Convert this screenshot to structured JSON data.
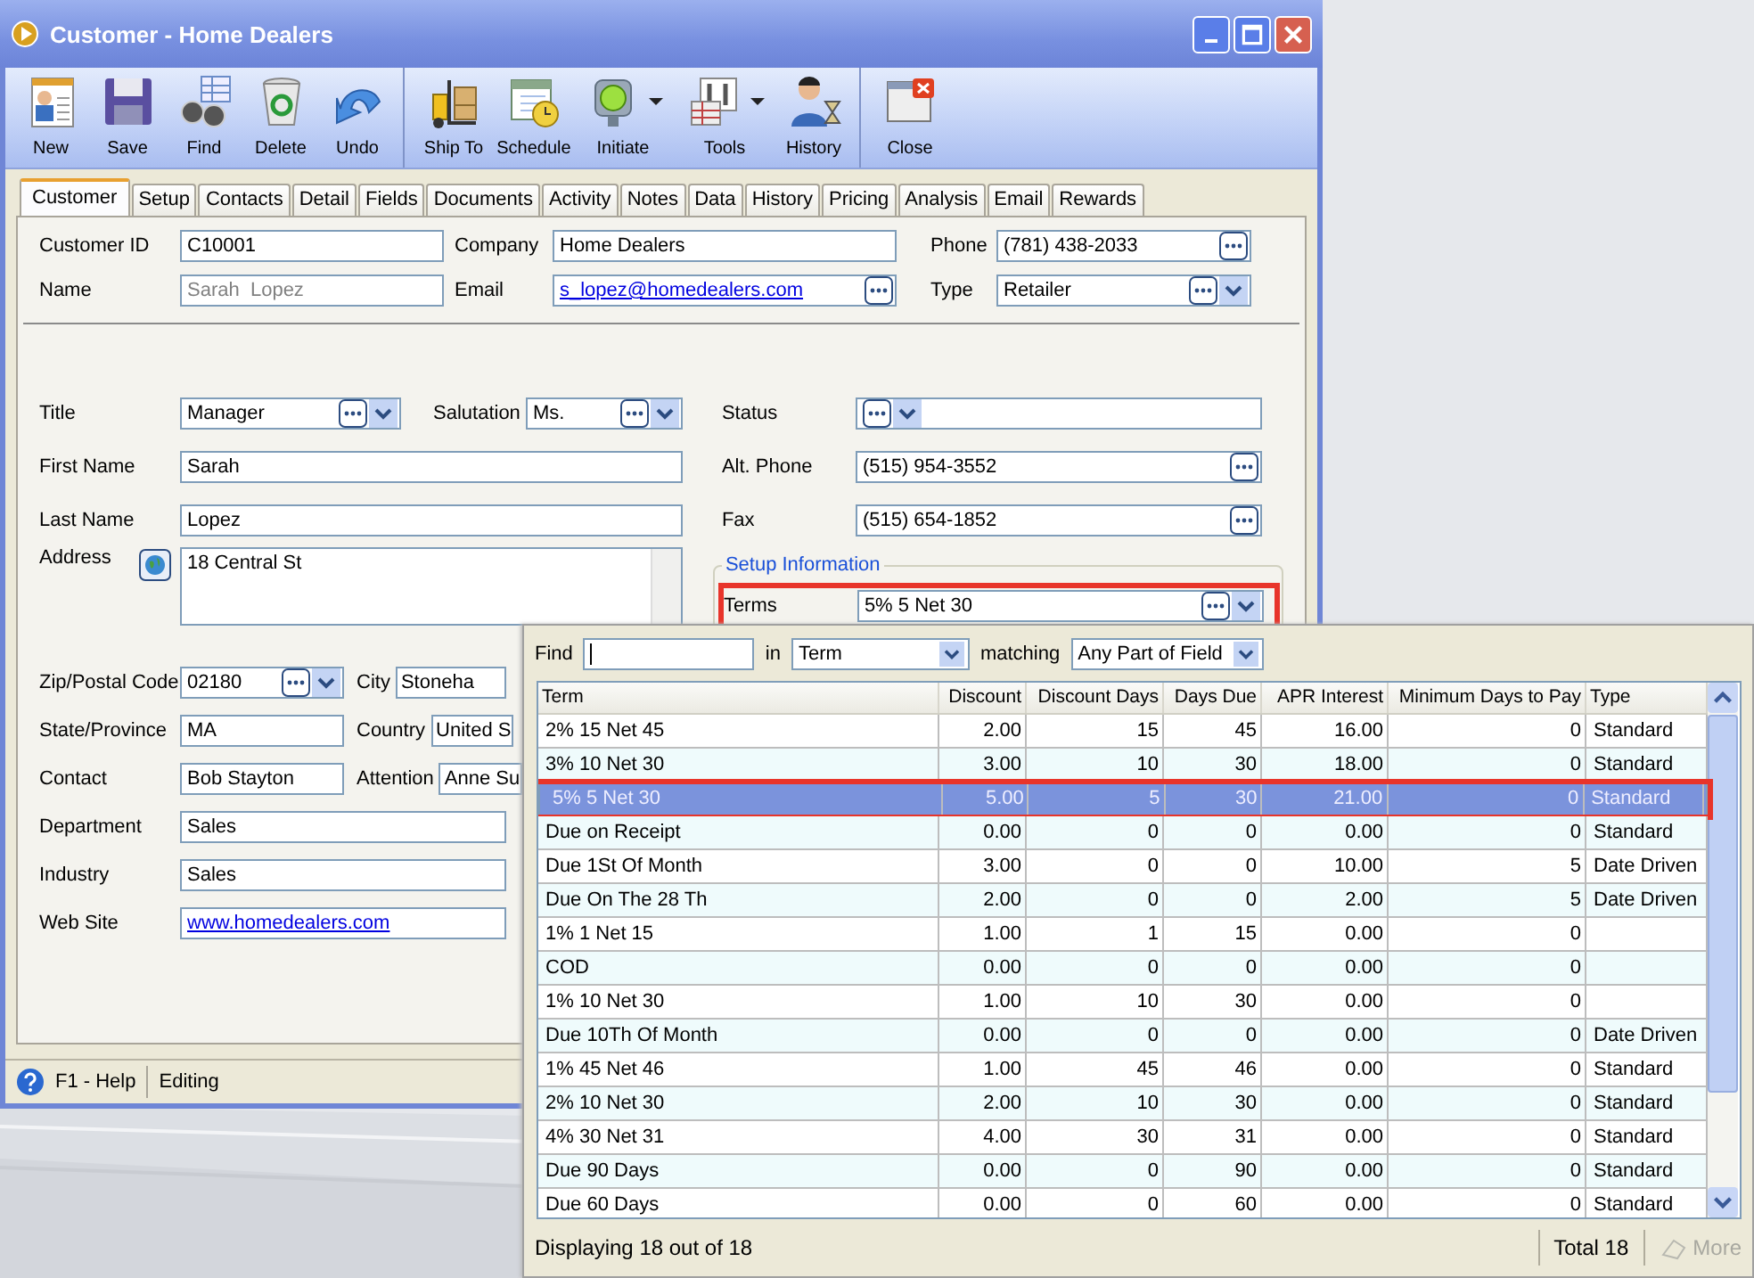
{
  "window": {
    "title": "Customer - Home Dealers"
  },
  "toolbar": [
    {
      "label": "New",
      "menu": false,
      "separator_before": false
    },
    {
      "label": "Save",
      "menu": false,
      "separator_before": false
    },
    {
      "label": "Find",
      "menu": false,
      "separator_before": false
    },
    {
      "label": "Delete",
      "menu": false,
      "separator_before": false
    },
    {
      "label": "Undo",
      "menu": false,
      "separator_before": false
    },
    {
      "label": "Ship To",
      "menu": false,
      "separator_before": true
    },
    {
      "label": "Schedule",
      "menu": false,
      "separator_before": false
    },
    {
      "label": "Initiate",
      "menu": true,
      "separator_before": false
    },
    {
      "label": "Tools",
      "menu": true,
      "separator_before": false
    },
    {
      "label": "History",
      "menu": false,
      "separator_before": false
    },
    {
      "label": "Close",
      "menu": false,
      "separator_before": true
    }
  ],
  "tabs": [
    {
      "label": "Customer",
      "selected": true
    },
    {
      "label": "Setup",
      "selected": false
    },
    {
      "label": "Contacts",
      "selected": false
    },
    {
      "label": "Detail",
      "selected": false
    },
    {
      "label": "Fields",
      "selected": false
    },
    {
      "label": "Documents",
      "selected": false
    },
    {
      "label": "Activity",
      "selected": false
    },
    {
      "label": "Notes",
      "selected": false
    },
    {
      "label": "Data",
      "selected": false
    },
    {
      "label": "History",
      "selected": false
    },
    {
      "label": "Pricing",
      "selected": false
    },
    {
      "label": "Analysis",
      "selected": false
    },
    {
      "label": "Email",
      "selected": false
    },
    {
      "label": "Rewards",
      "selected": false
    }
  ],
  "header_fields": [
    {
      "label": "Customer ID",
      "value": "C10001",
      "kind": "text"
    },
    {
      "label": "Company",
      "value": "Home Dealers",
      "kind": "text"
    },
    {
      "label": "Phone",
      "value": "(781) 438-2033",
      "kind": "lookup"
    },
    {
      "label": "Name",
      "value": "Sarah  Lopez",
      "kind": "readonly"
    },
    {
      "label": "Email",
      "value": "s_lopez@homedealers.com",
      "kind": "link-lookup"
    },
    {
      "label": "Type",
      "value": "Retailer",
      "kind": "combo"
    }
  ],
  "rows_top": [
    {
      "fields": [
        {
          "label": "Title",
          "value": "Manager",
          "kind": "combo"
        },
        {
          "label": "Salutation",
          "value": "Ms.",
          "kind": "combo"
        }
      ]
    },
    {
      "fields": [
        {
          "label": "First Name",
          "value": "Sarah",
          "kind": "text"
        }
      ]
    },
    {
      "fields": [
        {
          "label": "Last Name",
          "value": "Lopez",
          "kind": "text"
        }
      ]
    },
    {
      "fields": [
        {
          "label": "Address",
          "value": "18 Central St",
          "kind": "memo"
        }
      ]
    }
  ],
  "rows_bottom": [
    {
      "fields": [
        {
          "label": "Zip/Postal Code",
          "value": "02180",
          "kind": "combo"
        },
        {
          "label": "City",
          "value": "Stoneha",
          "kind": "text"
        }
      ]
    },
    {
      "fields": [
        {
          "label": "State/Province",
          "value": "MA",
          "kind": "text"
        },
        {
          "label": "Country",
          "value": "United S",
          "kind": "text"
        }
      ]
    },
    {
      "fields": [
        {
          "label": "Contact",
          "value": "Bob Stayton",
          "kind": "text"
        },
        {
          "label": "Attention",
          "value": "Anne Su",
          "kind": "text"
        }
      ]
    },
    {
      "fields": [
        {
          "label": "Department",
          "value": "Sales",
          "kind": "text"
        }
      ]
    },
    {
      "fields": [
        {
          "label": "Industry",
          "value": "Sales",
          "kind": "text"
        }
      ]
    },
    {
      "fields": [
        {
          "label": "Web Site",
          "value": "www.homedealers.com",
          "kind": "link"
        }
      ]
    }
  ],
  "right_fields": [
    {
      "label": "Status",
      "kind": "combo"
    },
    {
      "label": "Alt. Phone",
      "value": "(515) 954-3552",
      "kind": "lookup"
    },
    {
      "label": "Fax",
      "value": "(515) 654-1852",
      "kind": "lookup"
    }
  ],
  "setup_group": {
    "title": "Setup Information",
    "fields": [
      {
        "label": "Terms",
        "value": "5% 5 Net 30",
        "kind": "combo",
        "highlighted": true
      }
    ]
  },
  "status_bar": {
    "help": "F1 - Help",
    "mode": "Editing"
  },
  "popup": {
    "find_label": "Find",
    "in_label": "in",
    "in_value": "Term",
    "matching_label": "matching",
    "matching_value": "Any Part of Field",
    "columns": [
      "Term",
      "Discount",
      "Discount Days",
      "Days Due",
      "APR Interest",
      "Minimum Days to Pay",
      "Type"
    ],
    "rows": [
      {
        "cells": [
          "2% 15 Net 45",
          "2.00",
          "15",
          "45",
          "16.00",
          "0",
          "Standard"
        ],
        "selected": false
      },
      {
        "cells": [
          "3% 10 Net 30",
          "3.00",
          "10",
          "30",
          "18.00",
          "0",
          "Standard"
        ],
        "selected": false
      },
      {
        "cells": [
          "5% 5 Net 30",
          "5.00",
          "5",
          "30",
          "21.00",
          "0",
          "Standard"
        ],
        "selected": true
      },
      {
        "cells": [
          "Due on Receipt",
          "0.00",
          "0",
          "0",
          "0.00",
          "0",
          "Standard"
        ],
        "selected": false
      },
      {
        "cells": [
          "Due 1St Of Month",
          "3.00",
          "0",
          "0",
          "10.00",
          "5",
          "Date Driven"
        ],
        "selected": false
      },
      {
        "cells": [
          "Due On The  28 Th",
          "2.00",
          "0",
          "0",
          "2.00",
          "5",
          "Date Driven"
        ],
        "selected": false
      },
      {
        "cells": [
          "1% 1 Net 15",
          "1.00",
          "1",
          "15",
          "0.00",
          "0",
          ""
        ],
        "selected": false
      },
      {
        "cells": [
          "COD",
          "0.00",
          "0",
          "0",
          "0.00",
          "0",
          ""
        ],
        "selected": false
      },
      {
        "cells": [
          "1% 10 Net 30",
          "1.00",
          "10",
          "30",
          "0.00",
          "0",
          ""
        ],
        "selected": false
      },
      {
        "cells": [
          "Due 10Th Of Month",
          "0.00",
          "0",
          "0",
          "0.00",
          "0",
          "Date Driven"
        ],
        "selected": false
      },
      {
        "cells": [
          "1% 45 Net 46",
          "1.00",
          "45",
          "46",
          "0.00",
          "0",
          "Standard"
        ],
        "selected": false
      },
      {
        "cells": [
          "2% 10 Net 30",
          "2.00",
          "10",
          "30",
          "0.00",
          "0",
          "Standard"
        ],
        "selected": false
      },
      {
        "cells": [
          "4% 30 Net 31",
          "4.00",
          "30",
          "31",
          "0.00",
          "0",
          "Standard"
        ],
        "selected": false
      },
      {
        "cells": [
          "Due 90 Days",
          "0.00",
          "0",
          "90",
          "0.00",
          "0",
          "Standard"
        ],
        "selected": false
      },
      {
        "cells": [
          "Due 60 Days",
          "0.00",
          "0",
          "60",
          "0.00",
          "0",
          "Standard"
        ],
        "selected": false
      }
    ],
    "footer": "Displaying 18 out of 18",
    "total": "Total 18",
    "more": {
      "label": "More",
      "disabled": true
    }
  }
}
